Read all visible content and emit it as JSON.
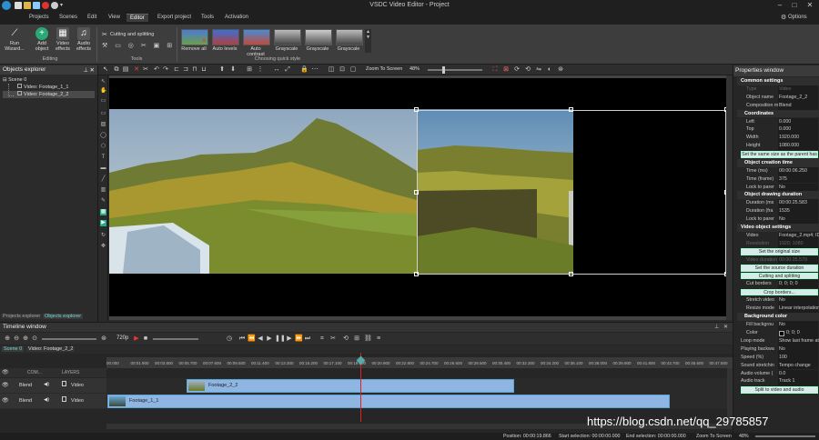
{
  "app": {
    "title": "VSDC Video Editor - Project",
    "options_label": "Options"
  },
  "menu": [
    "Projects",
    "Scenes",
    "Edit",
    "View",
    "Editor",
    "Export project",
    "Tools",
    "Activation"
  ],
  "ribbon": {
    "run_wizard": "Run Wizard...",
    "add_object": "Add object",
    "video_effects": "Video effects",
    "audio_effects": "Audio effects",
    "editing_group": "Editing",
    "cutting_splitting": "Cutting and splitting",
    "tools_group": "Tools",
    "quick_styles": [
      "Remove all",
      "Auto levels",
      "Auto contrast",
      "Grayscale",
      "Grayscale",
      "Grayscale"
    ],
    "quick_style_group": "Choosing quick style"
  },
  "toolbar": {
    "zoom_label": "Zoom To Screen",
    "zoom_value": "48%"
  },
  "objects_explorer": {
    "title": "Objects explorer",
    "tree": [
      "Scene 0",
      "Video: Footage_1_1",
      "Video: Footage_2_2"
    ],
    "tabs": [
      "Projects explorer",
      "Objects explorer"
    ]
  },
  "properties": {
    "title": "Properties window",
    "common_settings": "Common settings",
    "type_label": "Type",
    "type_value": "Video",
    "object_name_label": "Object name",
    "object_name_value": "Footage_2_2",
    "composition_label": "Composition m",
    "composition_value": "Blend",
    "coordinates": "Coordinates",
    "left_label": "Left",
    "left_value": "0.000",
    "top_label": "Top",
    "top_value": "0.000",
    "width_label": "Width",
    "width_value": "1920.000",
    "height_label": "Height",
    "height_value": "1080.000",
    "same_size_btn": "Set the same size as the parent has",
    "creation_time": "Object creation time",
    "time_ms_label": "Time (ms)",
    "time_ms_value": "00:00:06.250",
    "time_frame_label": "Time (frame)",
    "time_frame_value": "375",
    "lock_parent_label": "Lock to parer",
    "lock_parent_value": "No",
    "drawing_duration": "Object drawing duration",
    "duration_ms_label": "Duration (ms",
    "duration_ms_value": "00:00:25.583",
    "duration_fr_label": "Duration (fra",
    "duration_fr_value": "1535",
    "lock_parent2_label": "Lock to parer",
    "lock_parent2_value": "No",
    "video_object_settings": "Video object settings",
    "video_label": "Video",
    "video_value": "Footage_2.mp4; ID",
    "resolution_label": "Resolution",
    "resolution_value": "1920; 1080",
    "original_size_btn": "Set the original size",
    "video_duration_label": "Video duration",
    "video_duration_value": "00:00:25.579",
    "source_duration_btn": "Set the source duration",
    "cutting_btn": "Cutting and splitting",
    "cut_borders_label": "Cut borders",
    "cut_borders_value": "0; 0; 0; 0",
    "crop_borders_btn": "Crop borders...",
    "stretch_label": "Stretch video",
    "stretch_value": "No",
    "resize_label": "Resize mode",
    "resize_value": "Linear interpolation",
    "background_color": "Background color",
    "fill_bg_label": "Fill backgrou",
    "fill_bg_value": "No",
    "color_label": "Color",
    "color_value": "0; 0; 0",
    "loop_label": "Loop mode",
    "loop_value": "Show last frame at",
    "play_back_label": "Playing backwa",
    "play_back_value": "No",
    "speed_label": "Speed (%)",
    "speed_value": "100",
    "sound_label": "Sound stretchin",
    "sound_value": "Tempo change",
    "audio_vol_label": "Audio volume (",
    "audio_vol_value": "0.0",
    "audio_track_label": "Audio track",
    "audio_track_value": "Track 1",
    "split_btn": "Split to video and audio"
  },
  "timeline": {
    "title": "Timeline window",
    "resolution": "720p",
    "tabs": [
      "Scene 0",
      "Video: Footage_2_2"
    ],
    "header_com": "COM...",
    "header_layers": "LAYERS",
    "ruler": [
      "00.000",
      "00:01.900",
      "00:03.800",
      "00:05.700",
      "00:07.600",
      "00:09.500",
      "00:11.400",
      "00:13.300",
      "00:15.200",
      "00:17.100",
      "00:19.000",
      "00:20.900",
      "00:22.800",
      "00:24.700",
      "00:26.600",
      "00:28.500",
      "00:30.400",
      "00:32.300",
      "00:34.200",
      "00:36.100",
      "00:38.000",
      "00:39.900",
      "00:41.800",
      "00:43.700",
      "00:45.600",
      "00:47.500"
    ],
    "tracks": [
      {
        "blend": "Blend",
        "type": "Video",
        "clip": "Footage_2_2"
      },
      {
        "blend": "Blend",
        "type": "Video",
        "clip": "Footage_1_1"
      }
    ]
  },
  "status": {
    "position_label": "Position:",
    "position_value": "00:00:19.866",
    "start_sel_label": "Start selection:",
    "start_sel_value": "00:00:00.000",
    "end_sel_label": "End selection:",
    "end_sel_value": "00:00:00.000",
    "zoom_label": "Zoom To Screen",
    "zoom_value": "48%"
  },
  "watermark": "https://blog.csdn.net/qq_29785857"
}
